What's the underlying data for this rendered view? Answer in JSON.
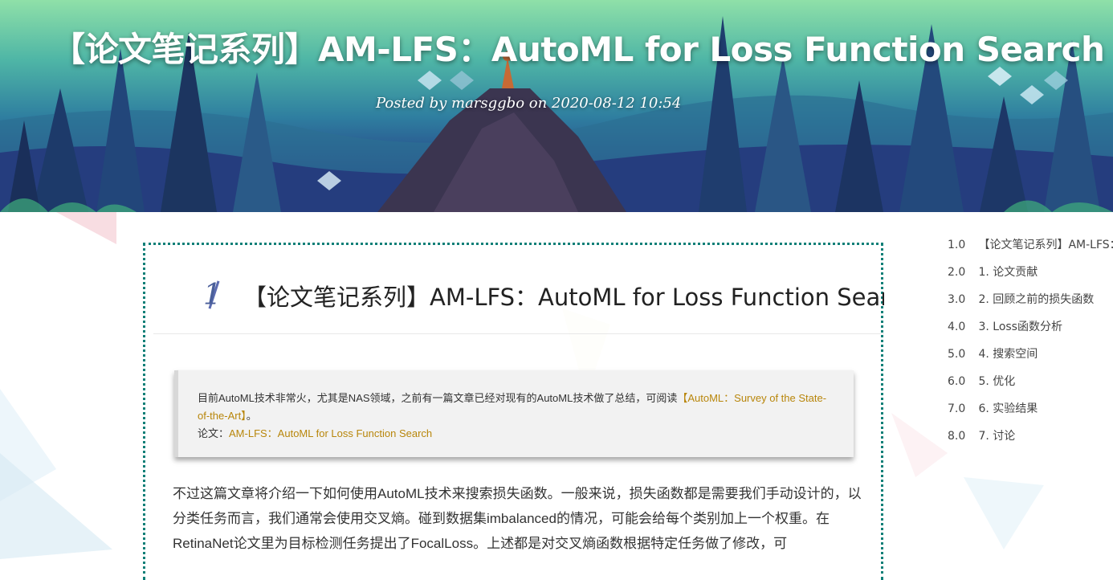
{
  "header": {
    "title": "【论文笔记系列】AM-LFS：AutoML for Loss Function Search",
    "posted": "Posted by marsggbo on 2020-08-12 10:54"
  },
  "section": {
    "number": "1",
    "title": "【论文笔记系列】AM-LFS：AutoML for Loss Function Search"
  },
  "quote": {
    "line1": "目前AutoML技术非常火，尤其是NAS领域，之前有一篇文章已经对现有的AutoML技术做了总结，可阅读",
    "link1": "【AutoML：Survey of the State-of-the-Art】",
    "line1_end": "。",
    "paper_label": "论文：",
    "paper_link": "AM-LFS：AutoML for Loss Function Search"
  },
  "body": {
    "paragraph": "不过这篇文章将介绍一下如何使用AutoML技术来搜索损失函数。一般来说，损失函数都是需要我们手动设计的，以分类任务而言，我们通常会使用交叉熵。碰到数据集imbalanced的情况，可能会给每个类别加上一个权重。在RetinaNet论文里为目标检测任务提出了FocalLoss。上述都是对交叉熵函数根据特定任务做了修改，可"
  },
  "toc": {
    "items": [
      {
        "num": "1.0",
        "label": "【论文笔记系列】AM-LFS：AutoML for Loss Function Search"
      },
      {
        "num": "2.0",
        "label": "1. 论文贡献"
      },
      {
        "num": "3.0",
        "label": "2. 回顾之前的损失函数"
      },
      {
        "num": "4.0",
        "label": "3. Loss函数分析"
      },
      {
        "num": "5.0",
        "label": "4. 搜索空间"
      },
      {
        "num": "6.0",
        "label": "5. 优化"
      },
      {
        "num": "7.0",
        "label": "6. 实验结果"
      },
      {
        "num": "8.0",
        "label": "7. 讨论"
      }
    ]
  },
  "colors": {
    "accent_border": "#0e7f77",
    "link": "#b8860b"
  }
}
